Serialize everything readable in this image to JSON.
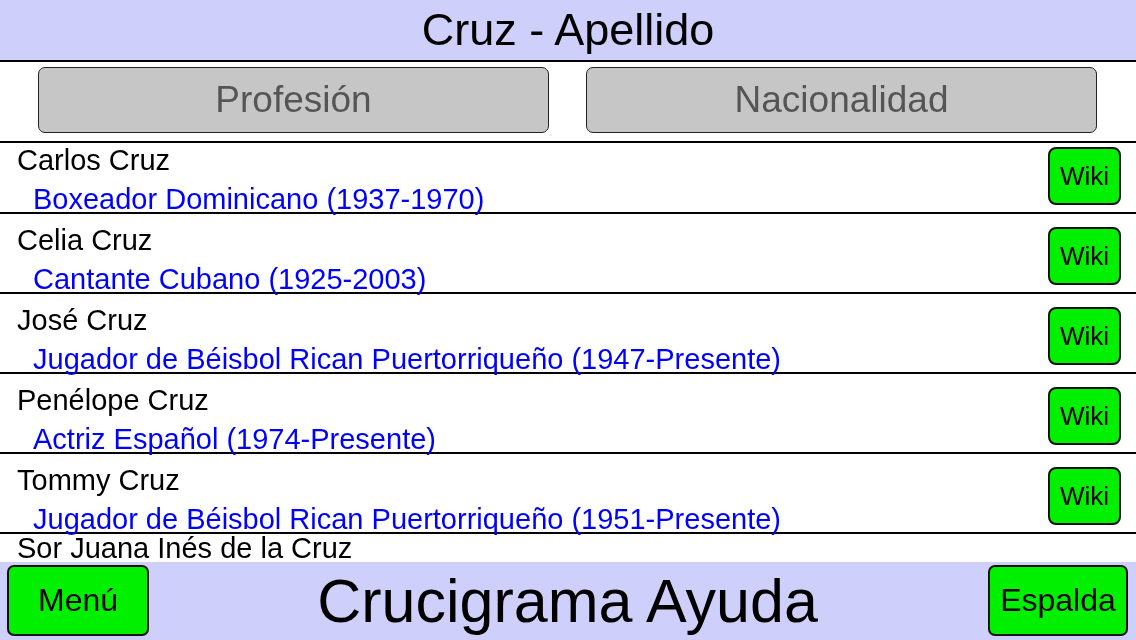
{
  "header": {
    "title": "Cruz - Apellido"
  },
  "filter_buttons": [
    {
      "label": "Profesión"
    },
    {
      "label": "Nacionalidad"
    }
  ],
  "results": [
    {
      "name": "Carlos Cruz",
      "description": "Boxeador Dominicano (1937-1970)",
      "button": "Wiki"
    },
    {
      "name": "Celia Cruz",
      "description": "Cantante Cubano (1925-2003)",
      "button": "Wiki"
    },
    {
      "name": "José Cruz",
      "description": "Jugador de Béisbol Rican Puertorriqueño (1947-Presente)",
      "button": "Wiki"
    },
    {
      "name": "Penélope Cruz",
      "description": "Actriz Español (1974-Presente)",
      "button": "Wiki"
    },
    {
      "name": "Tommy Cruz",
      "description": "Jugador de Béisbol Rican Puertorriqueño (1951-Presente)",
      "button": "Wiki"
    },
    {
      "name": "Sor Juana Inés de la Cruz"
    }
  ],
  "footer": {
    "left_button": {
      "label": "Menú"
    },
    "title": "Crucigrama Ayuda",
    "right_button": {
      "label": "Espalda"
    }
  }
}
